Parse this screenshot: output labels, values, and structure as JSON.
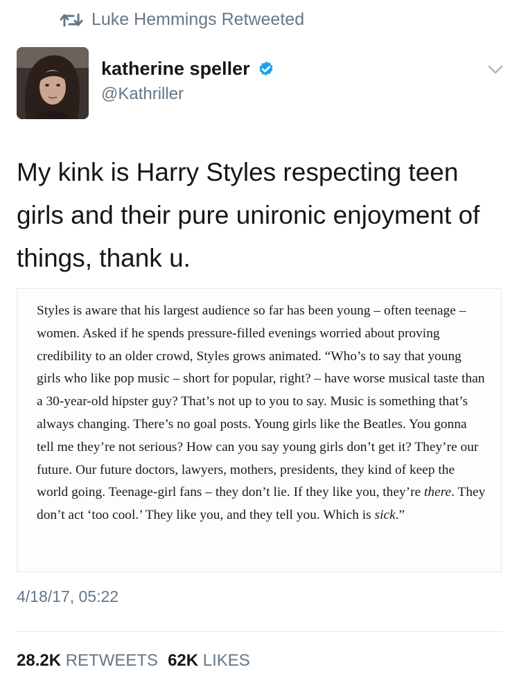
{
  "retweet_banner": {
    "text": "Luke Hemmings Retweeted"
  },
  "author": {
    "display_name": "katherine speller",
    "handle": "@Kathriller",
    "verified": true
  },
  "tweet": {
    "text": "My kink is Harry Styles respecting teen girls and their pure unironic enjoyment of things, thank u.",
    "image_quote": {
      "part1": "Styles is aware that his largest audience so far has been young – often teenage – women. Asked if he spends pressure-filled evenings worried about proving credibility to an older crowd, Styles grows animated. “Who’s to say that young girls who like pop music – short for popular, right? – have worse musical taste than a 30-year-old hipster guy? That’s not up to you to say. Music is something that’s always changing. There’s no goal posts. Young girls like the Beatles. You gonna tell me they’re not serious? How can you say young girls don’t get it? They’re our future. Our future doctors, lawyers, mothers, presidents, they kind of keep the world going. Teenage-girl fans – they don’t lie. If they like you, they’re ",
      "em1": "there",
      "part2": ". They don’t act ‘too cool.’ They like you, and they tell you. Which is ",
      "em2": "sick",
      "part3": ".”"
    },
    "timestamp": "4/18/17, 05:22"
  },
  "stats": {
    "retweets_count": "28.2K",
    "retweets_label": "RETWEETS",
    "likes_count": "62K",
    "likes_label": "LIKES"
  },
  "colors": {
    "text_primary": "#14171a",
    "text_secondary": "#657786",
    "verified_blue": "#1da1f2",
    "divider": "#e1e8ed"
  },
  "icons": [
    "retweet-icon",
    "verified-badge-icon",
    "chevron-down-icon"
  ]
}
